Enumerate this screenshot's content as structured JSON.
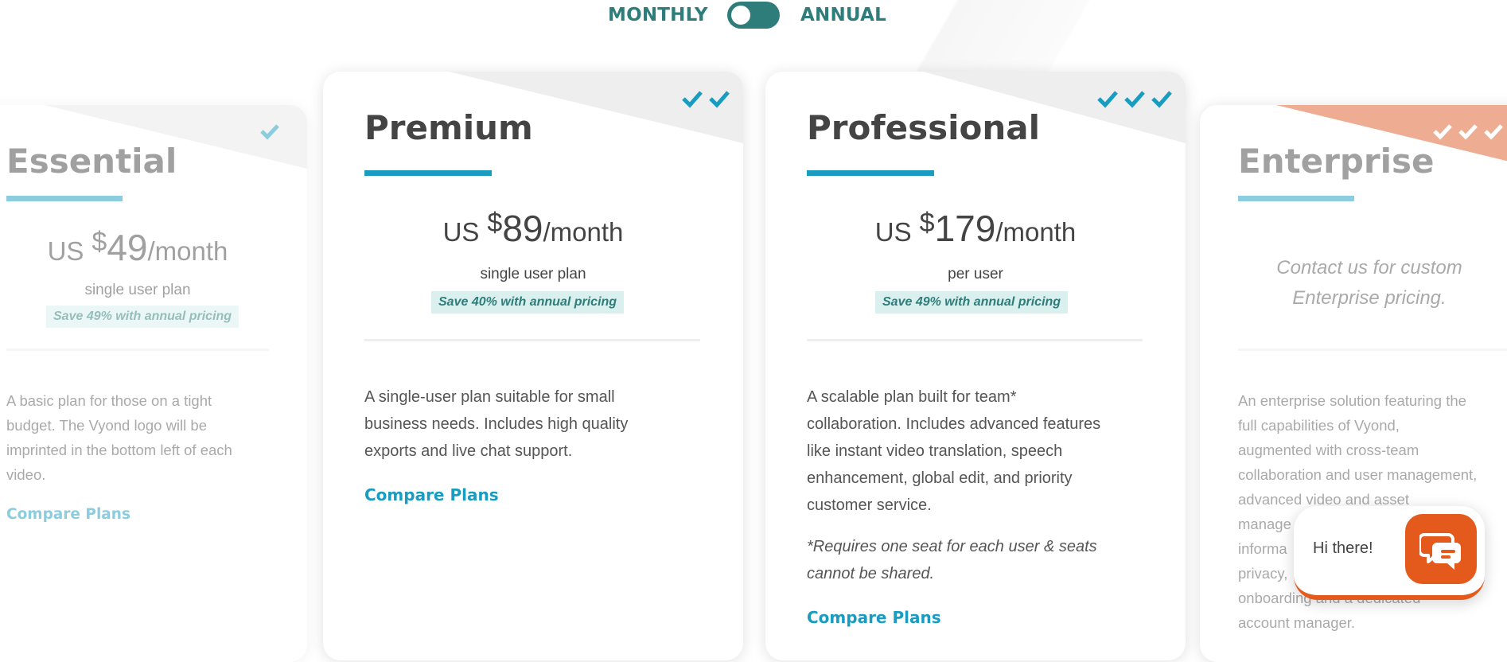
{
  "billing": {
    "monthly_label": "MONTHLY",
    "annual_label": "ANNUAL",
    "selected": "monthly"
  },
  "plans": [
    {
      "name": "Essential",
      "currency": "US",
      "symbol": "$",
      "amount": "49",
      "period": "/month",
      "subtitle": "single user plan",
      "save": "Save 49% with annual pricing",
      "description_lines": [
        "A basic plan for those on a tight",
        "budget. The Vyond logo will be",
        "imprinted in the bottom left of each",
        "video."
      ],
      "compare": "Compare Plans",
      "tick_count": 1
    },
    {
      "name": "Premium",
      "currency": "US",
      "symbol": "$",
      "amount": "89",
      "period": "/month",
      "subtitle": "single user plan",
      "save": "Save 40% with annual pricing",
      "description_lines": [
        "A single-user plan suitable for small",
        "business needs. Includes high quality",
        "exports and live chat support."
      ],
      "compare": "Compare Plans",
      "tick_count": 2
    },
    {
      "name": "Professional",
      "currency": "US",
      "symbol": "$",
      "amount": "179",
      "period": "/month",
      "subtitle": "per user",
      "save": "Save 49% with annual pricing",
      "description_lines": [
        "A scalable plan built for team*",
        "collaboration. Includes advanced features",
        "like instant video translation, speech",
        "enhancement, global edit, and priority",
        "customer service."
      ],
      "note_lines": [
        "*Requires one seat for each user & seats",
        "cannot be shared."
      ],
      "compare": "Compare Plans",
      "tick_count": 3
    },
    {
      "name": "Enterprise",
      "contact_lines": [
        "Contact us for custom",
        "Enterprise pricing."
      ],
      "description_lines": [
        "An enterprise solution featuring the",
        "full capabilities of Vyond,",
        "augmented with cross-team",
        "collaboration and user management,",
        "advanced video and asset",
        "manage",
        "informa",
        "privacy,",
        "onboarding and a dedicated",
        "account manager."
      ],
      "tick_count": 3
    }
  ],
  "chat": {
    "greeting": "Hi there!"
  },
  "colors": {
    "accent": "#1a9bc0",
    "teal": "#2e7d7a",
    "orange": "#e35a1c",
    "save_bg": "#d9f0ef"
  }
}
